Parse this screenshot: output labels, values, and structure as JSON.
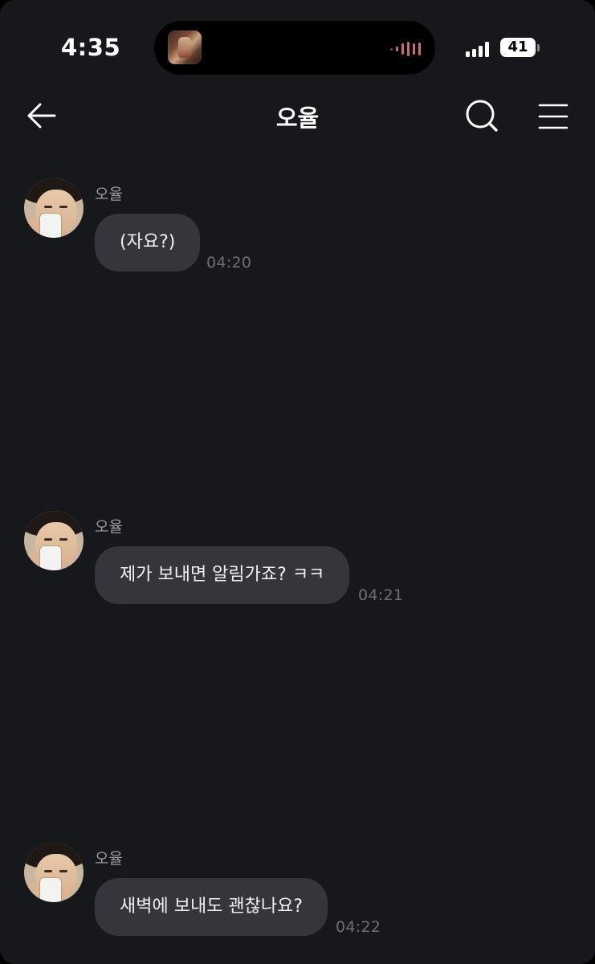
{
  "status_bar": {
    "time": "4:35",
    "battery": "41",
    "live_activity": {
      "artwork_icon": "album-artwork",
      "waveform_icon": "audio-waveform-icon",
      "accent_color": "#c96f6f"
    },
    "signal_icon": "cellular-signal-icon"
  },
  "nav": {
    "back_icon": "arrow-left-icon",
    "title": "오율",
    "search_icon": "search-icon",
    "menu_icon": "hamburger-menu-icon"
  },
  "messages": [
    {
      "sender": "오율",
      "text": "(자요?)",
      "time": "04:20"
    },
    {
      "sender": "오율",
      "text": "제가 보내면 알림가죠? ㅋㅋ",
      "time": "04:21"
    },
    {
      "sender": "오율",
      "text": "새벽에 보내도 괜찮나요?",
      "time": "04:22"
    }
  ],
  "colors": {
    "background": "#17181c",
    "bubble": "#35363b",
    "bubble_text": "#f0f0f2",
    "sender_text": "#9b9ca2",
    "timestamp_text": "#6e6f76"
  }
}
